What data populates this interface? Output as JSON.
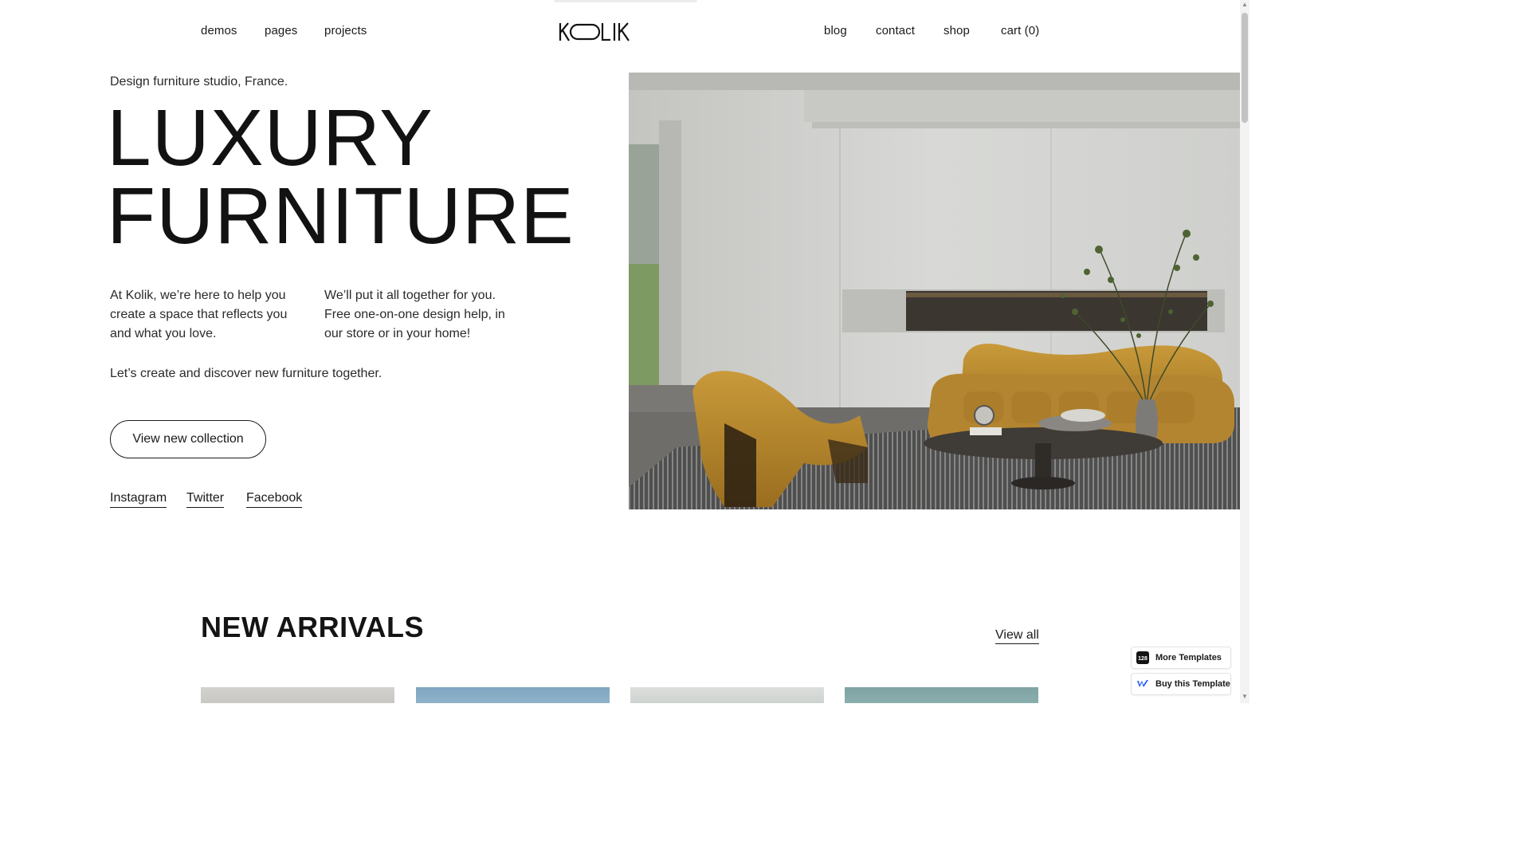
{
  "nav": {
    "left": [
      "demos",
      "pages",
      "projects"
    ],
    "right": [
      "blog",
      "contact",
      "shop",
      "cart (0)"
    ],
    "logo_text": "KOLIK"
  },
  "hero": {
    "tagline": "Design furniture studio, France.",
    "title_line1": "LUXURY",
    "title_line2": "FURNITURE",
    "paragraph_left": "At Kolik, we’re here to help you create a space that reflects you and what you love.",
    "paragraph_right": "We’ll put it all together for you. Free one-on-one design help, in our store or in your home!",
    "cta_text": "Let’s create and discover new furniture together.",
    "button_label": "View new collection",
    "social_links": [
      "Instagram",
      "Twitter",
      "Facebook"
    ]
  },
  "arrivals": {
    "title": "NEW ARRIVALS",
    "view_all": "View all"
  },
  "badges": {
    "more_templates": "More Templates",
    "buy_template": "Buy this Template",
    "more_templates_icon_text": "128"
  },
  "colors": {
    "text": "#141414",
    "sofa": "#b98a2c",
    "wall": "#d9d9d6",
    "card_blue": "#7fa6c2",
    "card_teal": "#7fa3a3"
  }
}
